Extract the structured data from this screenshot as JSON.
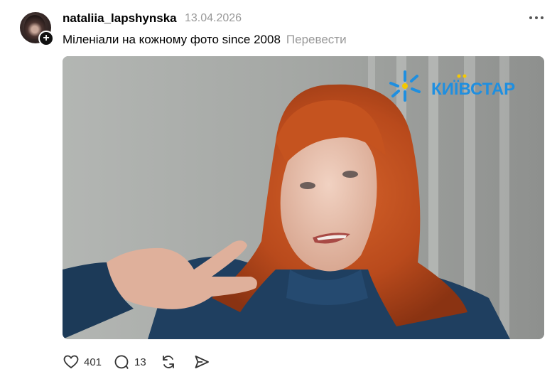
{
  "post": {
    "username": "nataliia_lapshynska",
    "date": "13.04.2026",
    "caption": "Міленіали на кожному фото since 2008",
    "translate_label": "Перевести",
    "media": {
      "watermark": "КИЇВСТАР"
    },
    "stats": {
      "likes": "401",
      "comments": "13"
    }
  },
  "colors": {
    "watermark_blue": "#1f8fe0",
    "watermark_yellow": "#f5c800",
    "muted_text": "#999999"
  },
  "icons": [
    "plus-icon",
    "more-icon",
    "heart-icon",
    "comment-icon",
    "repost-icon",
    "share-icon"
  ]
}
